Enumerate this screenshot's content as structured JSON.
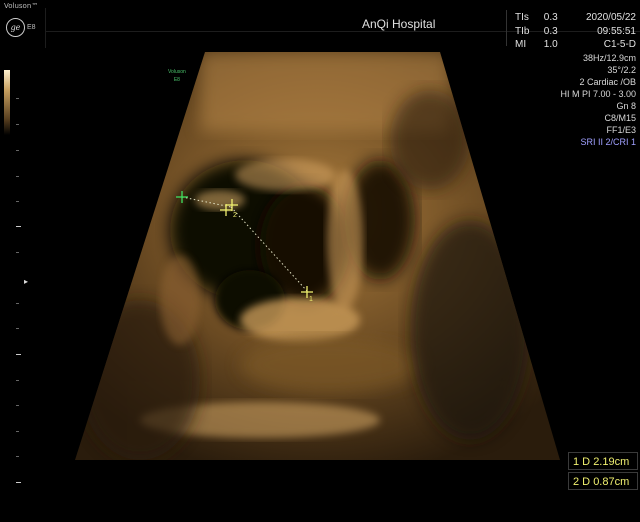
{
  "header": {
    "brand": "Voluson™",
    "brand_model": "E8",
    "hospital": "AnQi Hospital",
    "indices": [
      {
        "label": "TIs",
        "value": "0.3"
      },
      {
        "label": "TIb",
        "value": "0.3"
      },
      {
        "label": "MI",
        "value": "1.0"
      }
    ],
    "date": "2020/05/22",
    "time": "09:55:51",
    "probe": "C1-5-D"
  },
  "settings": {
    "line1": "38Hz/12.9cm",
    "line2": "35°/2.2",
    "line3": "2 Cardiac /OB",
    "line4": "HI M PI 7.00 - 3.00",
    "line5": "Gn  8",
    "line6": "C8/M15",
    "line7": "FF1/E3",
    "line8": "SRI II 2/CRI 1"
  },
  "image_label": {
    "brand": "Voluson",
    "model": "E8"
  },
  "measurements": [
    {
      "label": "1 D",
      "value": "2.19cm"
    },
    {
      "label": "2 D",
      "value": "0.87cm"
    }
  ],
  "caliper_labels": {
    "c1": "1",
    "c2": "2"
  },
  "colors": {
    "tissue": "#b08040",
    "caliper_green": "#40e060",
    "caliper_yellow": "#f0f070",
    "sri_text": "#a0a0ff"
  }
}
